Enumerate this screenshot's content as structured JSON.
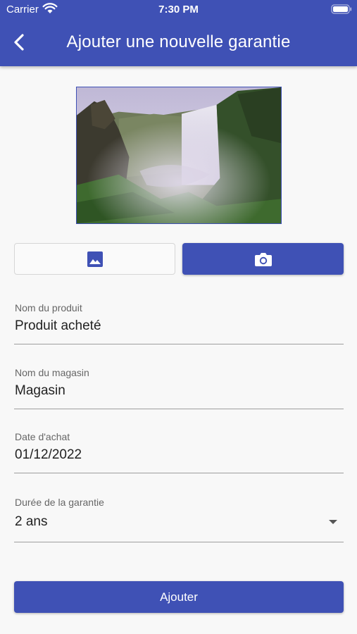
{
  "status_bar": {
    "carrier": "Carrier",
    "time": "7:30 PM"
  },
  "appbar": {
    "title": "Ajouter une nouvelle garantie",
    "back_icon": "chevron-left-icon",
    "color": "#3f51b5"
  },
  "photo": {
    "description_icon": "landscape-photo"
  },
  "buttons": {
    "gallery_icon": "image-icon",
    "camera_icon": "camera-icon"
  },
  "form": {
    "product": {
      "label": "Nom du produit",
      "value": "Produit acheté"
    },
    "store": {
      "label": "Nom du magasin",
      "value": "Magasin"
    },
    "purchase_date": {
      "label": "Date d'achat",
      "value": "01/12/2022"
    },
    "warranty": {
      "label": "Durée de la garantie",
      "value": "2 ans"
    }
  },
  "submit_label": "Ajouter"
}
